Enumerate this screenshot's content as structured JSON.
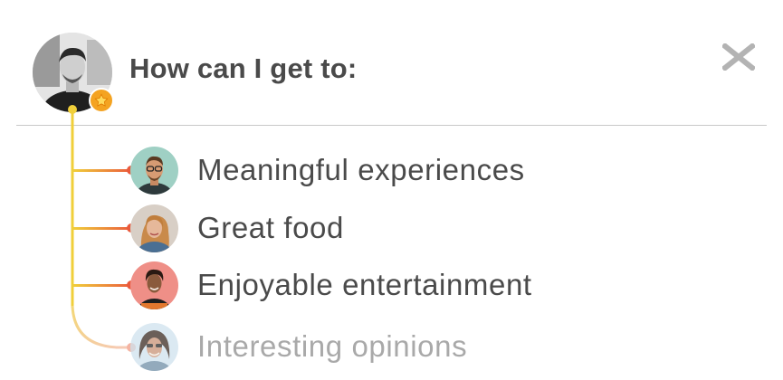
{
  "header": {
    "title": "How can I get to:",
    "avatar_icon": "user-avatar-icon",
    "badge_icon": "star-icon",
    "close_label": "X"
  },
  "colors": {
    "title_text": "#4a4a4a",
    "faded_text": "#a9a9a9",
    "tree_line": "#f0cf3a",
    "branch_end": "#ea5a3c",
    "badge": "#f4a321",
    "close": "#b3b3b3",
    "divider": "#c8c8c8"
  },
  "items": [
    {
      "label": "Meaningful experiences",
      "faded": false,
      "avatar_icon": "person-avatar-icon"
    },
    {
      "label": "Great food",
      "faded": false,
      "avatar_icon": "person-avatar-icon"
    },
    {
      "label": "Enjoyable entertainment",
      "faded": false,
      "avatar_icon": "person-avatar-icon"
    },
    {
      "label": "Interesting opinions",
      "faded": true,
      "avatar_icon": "person-avatar-icon"
    }
  ]
}
